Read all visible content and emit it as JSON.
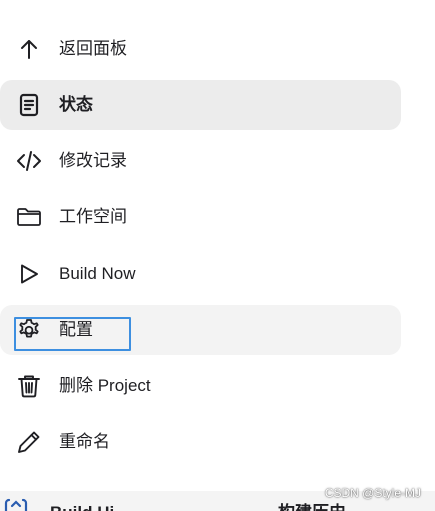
{
  "menu": {
    "items": [
      {
        "label": "返回面板",
        "icon": "arrow-up-icon"
      },
      {
        "label": "状态",
        "icon": "document-icon",
        "state": "active"
      },
      {
        "label": "修改记录",
        "icon": "code-icon"
      },
      {
        "label": "工作空间",
        "icon": "folder-icon"
      },
      {
        "label": "Build Now",
        "icon": "play-icon"
      },
      {
        "label": "配置",
        "icon": "gear-icon",
        "state": "hover-focused"
      },
      {
        "label": "删除 Project",
        "icon": "trash-icon"
      },
      {
        "label": "重命名",
        "icon": "pencil-icon"
      }
    ]
  },
  "bottom": {
    "left_text": "Build Hi",
    "right_text": "构建历史"
  },
  "watermark": "CSDN @Style-MJ",
  "colors": {
    "active_bg": "#ececec",
    "hover_bg": "#f3f3f3",
    "focus_ring": "#3d8fe0",
    "text": "#1f1f23",
    "bottom_icon": "#2a5db0"
  }
}
